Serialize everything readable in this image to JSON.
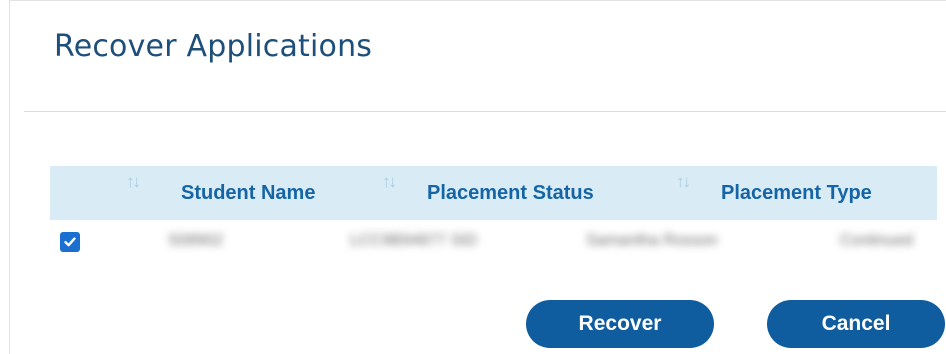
{
  "dialog": {
    "title": "Recover Applications"
  },
  "table": {
    "columns": [
      {
        "label": "",
        "sort_icon": "↑↓"
      },
      {
        "label": "Student Name",
        "sort_icon": "↑↓"
      },
      {
        "label": "Placement Status",
        "sort_icon": "↑↓"
      },
      {
        "label": "Placement Type",
        "sort_icon": ""
      }
    ],
    "rows": [
      {
        "checked": true,
        "cells": [
          "S08902",
          "LCC9B94877 SID",
          "Samantha Rosson",
          "Continued"
        ]
      }
    ]
  },
  "actions": {
    "recover_label": "Recover",
    "cancel_label": "Cancel"
  },
  "colors": {
    "title": "#1d4f7a",
    "header_bg": "#d9ecf5",
    "header_text": "#1565a6",
    "button_bg": "#0f5c9e",
    "checkbox": "#1a6fd1"
  }
}
